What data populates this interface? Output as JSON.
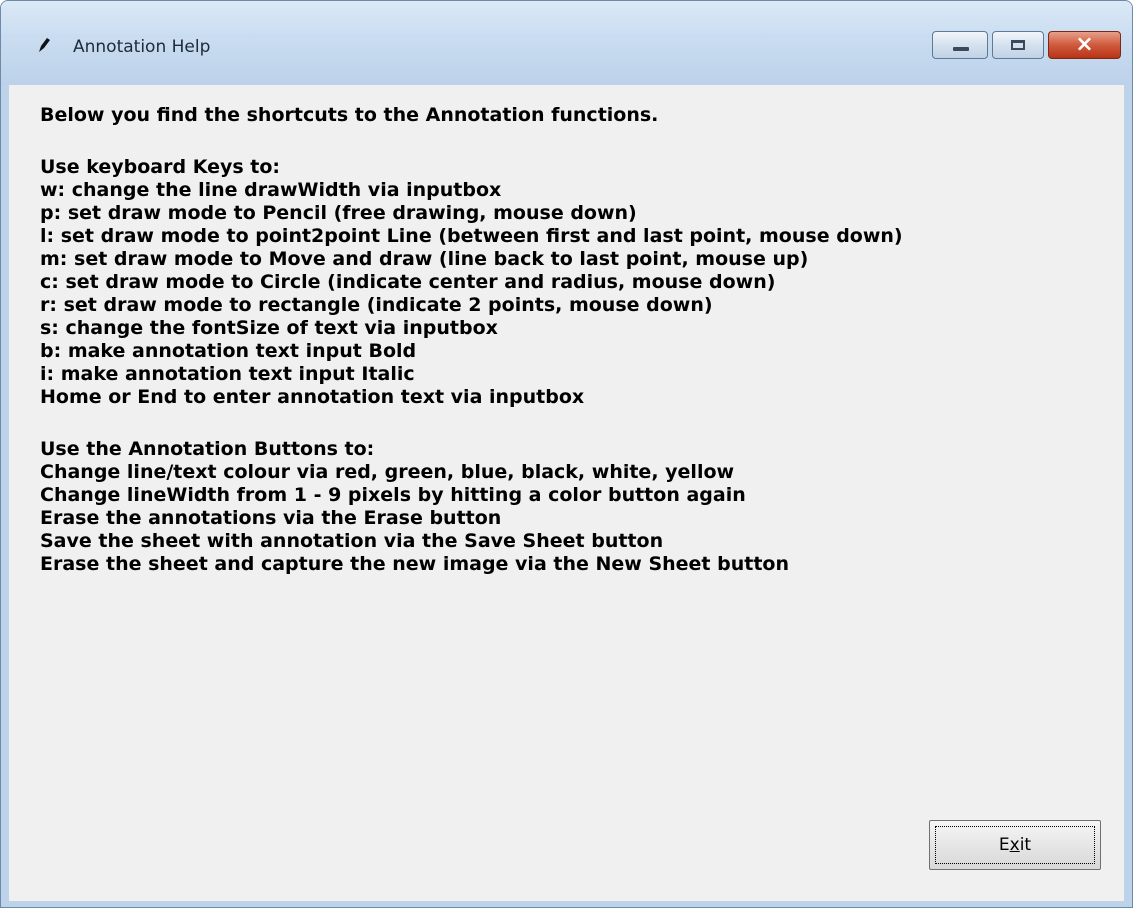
{
  "window": {
    "title": "Annotation Help",
    "icon": "pencil-icon",
    "controls": {
      "minimize": "minimize-icon",
      "maximize": "maximize-icon",
      "close": "×"
    }
  },
  "content": {
    "intro": "Below you find the shortcuts to the Annotation functions.",
    "keys_heading": "Use keyboard Keys to:",
    "key_lines": [
      "w:   change the line drawWidth via inputbox",
      "p:   set draw mode to Pencil (free drawing, mouse down)",
      "l:   set draw mode to point2point Line (between first and last point, mouse down)",
      "m:   set draw mode to Move and draw (line back to last point, mouse up)",
      "c:   set draw mode to Circle (indicate center and radius, mouse down)",
      "r:   set draw mode to rectangle (indicate 2 points, mouse down)",
      "s:   change the fontSize of text via inputbox",
      "b:   make annotation text input Bold",
      "i:   make annotation text input Italic",
      "Home or End to enter annotation text via inputbox"
    ],
    "buttons_heading": "Use the Annotation Buttons to:",
    "button_lines": [
      "Change line/text colour via red, green, blue, black, white, yellow",
      "Change lineWidth from 1 - 9 pixels by hitting a color button again",
      "Erase the annotations via the Erase button",
      "Save the sheet with annotation via the Save Sheet button",
      "Erase the sheet and capture the new image via the New Sheet button"
    ]
  },
  "exit_button": {
    "label": "Exit",
    "mnemonic": "x"
  }
}
